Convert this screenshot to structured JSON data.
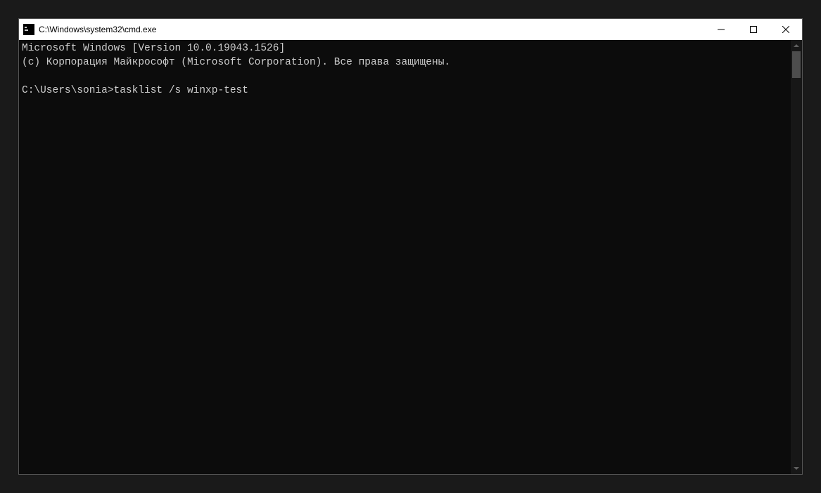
{
  "window": {
    "title": "C:\\Windows\\system32\\cmd.exe"
  },
  "console": {
    "lines": [
      "Microsoft Windows [Version 10.0.19043.1526]",
      "(c) Корпорация Майкрософт (Microsoft Corporation). Все права защищены.",
      "",
      "C:\\Users\\sonia>tasklist /s winxp-test"
    ]
  }
}
